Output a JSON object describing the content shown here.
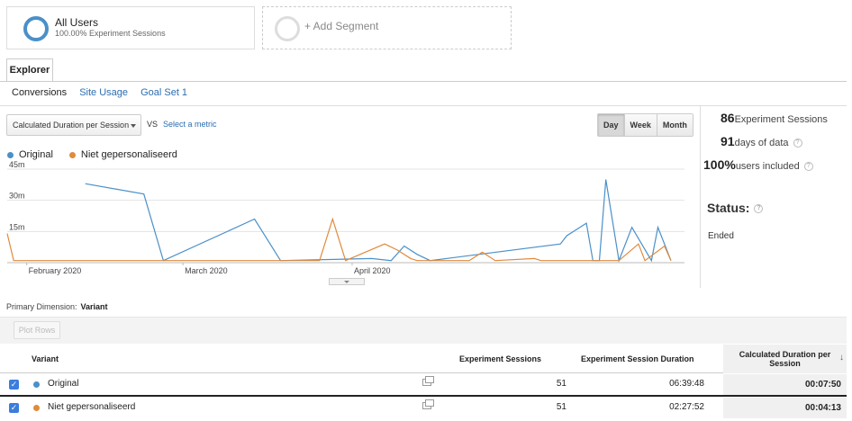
{
  "segments": {
    "all": {
      "title": "All Users",
      "subtitle": "100.00% Experiment Sessions"
    },
    "add": {
      "label": "+ Add Segment"
    }
  },
  "tabs": {
    "explorer": "Explorer"
  },
  "subtabs": [
    {
      "label": "Conversions",
      "active": true
    },
    {
      "label": "Site Usage",
      "active": false
    },
    {
      "label": "Goal Set 1",
      "active": false
    }
  ],
  "metric": {
    "selected": "Calculated Duration per Session",
    "vs": "VS",
    "select_metric": "Select a metric"
  },
  "range": {
    "day": "Day",
    "week": "Week",
    "month": "Month"
  },
  "legend": [
    {
      "name": "Original",
      "color": "#4a90c9"
    },
    {
      "name": "Niet gepersonaliseerd",
      "color": "#e08a3c"
    }
  ],
  "stats": {
    "sessions_value": "86",
    "sessions_label": "Experiment Sessions",
    "days_value": "91",
    "days_label": "days of data",
    "users_value": "100%",
    "users_label": "users included",
    "status_label": "Status:",
    "status_value": "Ended"
  },
  "chart_data": {
    "type": "line",
    "y_ticks": [
      "45m",
      "30m",
      "15m"
    ],
    "ylim_minutes": [
      0,
      45
    ],
    "x_tick_labels": [
      "February 2020",
      "March 2020",
      "April 2020"
    ],
    "x_days": 91,
    "series": [
      {
        "name": "Original",
        "color": "#4a90c9",
        "points": [
          [
            12,
            38
          ],
          [
            21,
            33
          ],
          [
            24,
            1
          ],
          [
            38,
            21
          ],
          [
            42,
            1
          ],
          [
            56,
            2
          ],
          [
            59,
            1
          ],
          [
            61,
            8
          ],
          [
            63,
            4
          ],
          [
            65,
            1
          ],
          [
            85,
            9
          ],
          [
            86,
            13
          ],
          [
            89,
            19
          ],
          [
            90,
            1
          ],
          [
            91,
            1
          ],
          [
            92,
            40
          ],
          [
            94,
            1
          ],
          [
            96,
            17
          ],
          [
            99,
            1
          ],
          [
            100,
            17
          ],
          [
            102,
            1
          ]
        ]
      },
      {
        "name": "Niet gepersonaliseerd",
        "color": "#e08a3c",
        "points": [
          [
            0,
            14
          ],
          [
            1,
            1
          ],
          [
            48,
            1
          ],
          [
            50,
            21
          ],
          [
            52,
            1
          ],
          [
            58,
            9
          ],
          [
            60,
            6
          ],
          [
            62,
            2
          ],
          [
            63,
            1
          ],
          [
            66,
            1
          ],
          [
            71,
            1
          ],
          [
            73,
            5
          ],
          [
            75,
            1
          ],
          [
            81,
            2
          ],
          [
            82,
            1
          ],
          [
            91,
            1
          ],
          [
            92,
            1
          ],
          [
            94,
            1
          ],
          [
            97,
            9
          ],
          [
            98,
            1
          ],
          [
            101,
            8
          ],
          [
            102,
            1
          ]
        ]
      }
    ]
  },
  "table": {
    "primary_dimension_label": "Primary Dimension:",
    "primary_dimension_value": "Variant",
    "plot_rows": "Plot Rows",
    "headers": {
      "variant": "Variant",
      "sessions": "Experiment Sessions",
      "duration": "Experiment Session Duration",
      "calc": "Calculated Duration per Session"
    },
    "rows": [
      {
        "name": "Original",
        "color": "#4a90c9",
        "sessions": "51",
        "duration": "06:39:48",
        "calc": "00:07:50"
      },
      {
        "name": "Niet gepersonaliseerd",
        "color": "#e08a3c",
        "sessions": "51",
        "duration": "02:27:52",
        "calc": "00:04:13"
      }
    ]
  }
}
